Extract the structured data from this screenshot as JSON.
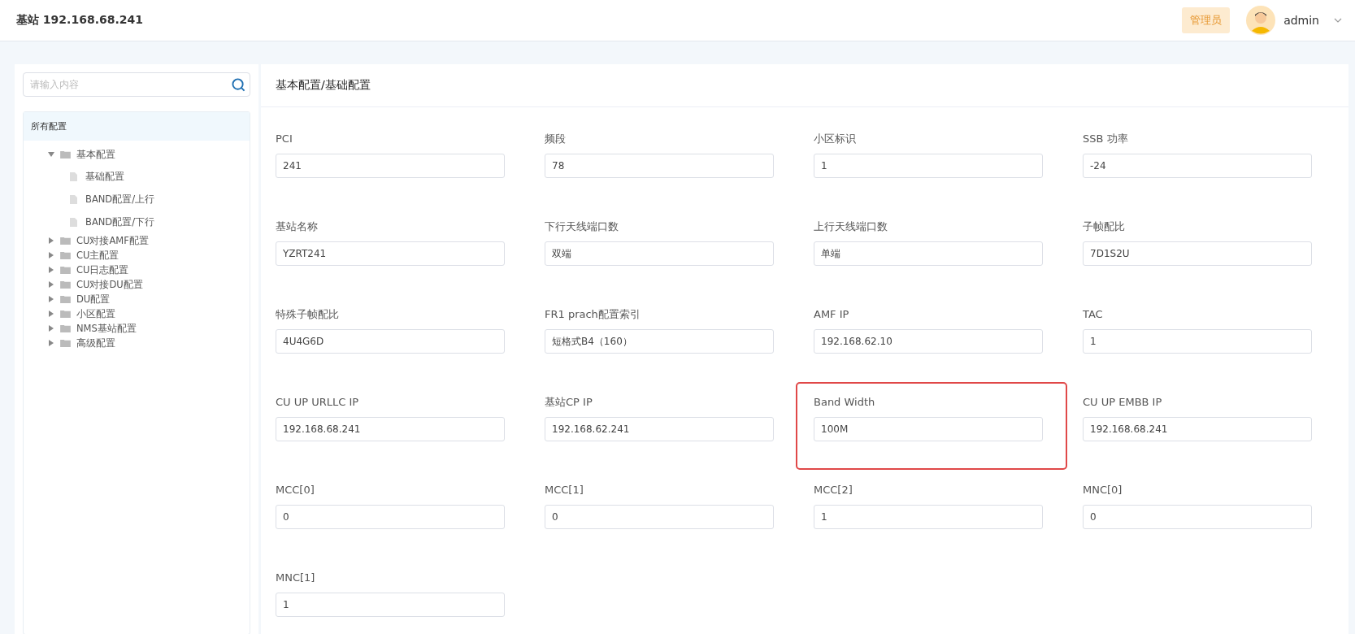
{
  "header": {
    "title": "基站 192.168.68.241",
    "role_badge": "管理员",
    "user": "admin"
  },
  "sidebar": {
    "search": {
      "placeholder": "请输入内容"
    },
    "tree_root": "所有配置",
    "tree": [
      {
        "label": "基本配置",
        "expanded": true,
        "children": [
          {
            "label": "基础配置"
          },
          {
            "label": "BAND配置/上行"
          },
          {
            "label": "BAND配置/下行"
          }
        ]
      },
      {
        "label": "CU对接AMF配置",
        "expanded": false
      },
      {
        "label": "CU主配置",
        "expanded": false
      },
      {
        "label": "CU日志配置",
        "expanded": false
      },
      {
        "label": "CU对接DU配置",
        "expanded": false
      },
      {
        "label": "DU配置",
        "expanded": false
      },
      {
        "label": "小区配置",
        "expanded": false
      },
      {
        "label": "NMS基站配置",
        "expanded": false
      },
      {
        "label": "高级配置",
        "expanded": false
      }
    ]
  },
  "content": {
    "breadcrumb": "基本配置/基础配置",
    "fields": [
      {
        "label": "PCI",
        "value": "241",
        "highlighted": false
      },
      {
        "label": "频段",
        "value": "78",
        "highlighted": false
      },
      {
        "label": "小区标识",
        "value": "1",
        "highlighted": false
      },
      {
        "label": "SSB 功率",
        "value": "-24",
        "highlighted": false
      },
      {
        "label": "基站名称",
        "value": "YZRT241",
        "highlighted": false
      },
      {
        "label": "下行天线端口数",
        "value": "双端",
        "highlighted": false
      },
      {
        "label": "上行天线端口数",
        "value": "单端",
        "highlighted": false
      },
      {
        "label": "子帧配比",
        "value": "7D1S2U",
        "highlighted": false
      },
      {
        "label": "特殊子帧配比",
        "value": "4U4G6D",
        "highlighted": false
      },
      {
        "label": "FR1 prach配置索引",
        "value": "短格式B4（160）",
        "highlighted": false
      },
      {
        "label": "AMF IP",
        "value": "192.168.62.10",
        "highlighted": false
      },
      {
        "label": "TAC",
        "value": "1",
        "highlighted": false
      },
      {
        "label": "CU UP URLLC IP",
        "value": "192.168.68.241",
        "highlighted": false
      },
      {
        "label": "基站CP IP",
        "value": "192.168.62.241",
        "highlighted": false
      },
      {
        "label": "Band Width",
        "value": "100M",
        "highlighted": true
      },
      {
        "label": "CU UP EMBB IP",
        "value": "192.168.68.241",
        "highlighted": false
      },
      {
        "label": "MCC[0]",
        "value": "0",
        "highlighted": false
      },
      {
        "label": "MCC[1]",
        "value": "0",
        "highlighted": false
      },
      {
        "label": "MCC[2]",
        "value": "1",
        "highlighted": false
      },
      {
        "label": "MNC[0]",
        "value": "0",
        "highlighted": false
      },
      {
        "label": "MNC[1]",
        "value": "1",
        "highlighted": false
      }
    ]
  }
}
